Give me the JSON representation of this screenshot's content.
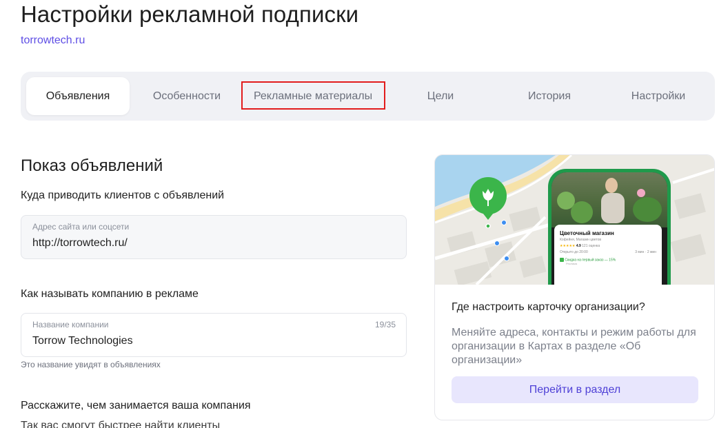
{
  "header": {
    "title": "Настройки рекламной подписки",
    "site": "torrowtech.ru"
  },
  "tabs": [
    {
      "label": "Объявления",
      "active": true
    },
    {
      "label": "Особенности",
      "active": false
    },
    {
      "label": "Рекламные материалы",
      "active": false,
      "highlighted": true
    },
    {
      "label": "Цели",
      "active": false
    },
    {
      "label": "История",
      "active": false
    },
    {
      "label": "Настройки",
      "active": false
    }
  ],
  "main": {
    "section_title": "Показ объявлений",
    "destination": {
      "label": "Куда приводить клиентов с объявлений",
      "caption": "Адрес сайта или соцсети",
      "value": "http://torrowtech.ru/"
    },
    "company_name": {
      "label": "Как называть компанию в рекламе",
      "caption": "Название компании",
      "value": "Torrow Technologies",
      "counter": "19/35",
      "hint": "Это название увидят в объявлениях"
    },
    "about": {
      "label": "Расскажите, чем занимается ваша компания",
      "subtext": "Так вас смогут быстрее найти клиенты"
    }
  },
  "side_card": {
    "preview": {
      "shop_name": "Цветочный магазин",
      "category": "Кофейня, Магазин цветов",
      "rating": "4.9",
      "reviews": "121 оценка",
      "open_until": "Открыто до 20:00",
      "walk": "3 мин",
      "drive": "2 мин",
      "promo": "Скидка на первый заказ — 15%",
      "promo_sub": "Реклама"
    },
    "heading": "Где настроить карточку организации?",
    "text": "Меняйте адреса, контакты и режим работы для организации в Картах в разделе «Об организации»",
    "button_label": "Перейти в раздел"
  },
  "colors": {
    "accent": "#5e4ee5",
    "highlight_border": "#e21b1b",
    "tabs_bg": "#f0f1f5",
    "pin_green": "#3bb54a"
  }
}
